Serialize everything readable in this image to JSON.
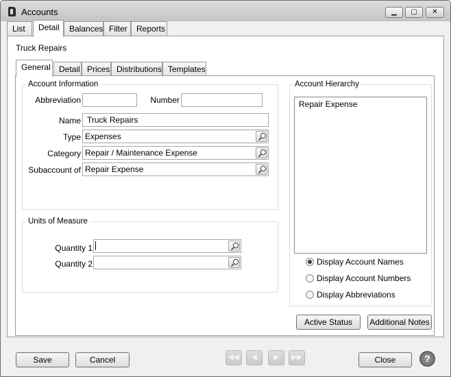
{
  "window": {
    "title": "Accounts",
    "minimize_icon": "minimize-icon",
    "maximize_icon": "maximize-icon",
    "close_icon": "close-icon"
  },
  "main_tabs": [
    "List",
    "Detail",
    "Balances",
    "Filter",
    "Reports"
  ],
  "main_tab_active": "Detail",
  "account_title": "Truck Repairs",
  "sub_tabs": [
    "General",
    "Detail",
    "Prices",
    "Distributions",
    "Templates"
  ],
  "sub_tab_active": "General",
  "account_info": {
    "title": "Account Information",
    "abbreviation_label": "Abbreviation",
    "abbreviation_value": "",
    "number_label": "Number",
    "number_value": "",
    "name_label": "Name",
    "name_value": "Truck Repairs",
    "type_label": "Type",
    "type_value": "Expenses",
    "category_label": "Category",
    "category_value": "Repair / Maintenance Expense",
    "subaccount_label": "Subaccount of",
    "subaccount_value": "Repair Expense"
  },
  "units": {
    "title": "Units of Measure",
    "qty1_label": "Quantity 1",
    "qty1_value": "",
    "qty2_label": "Quantity 2",
    "qty2_value": ""
  },
  "hierarchy": {
    "title": "Account Hierarchy",
    "items": [
      "Repair Expense"
    ],
    "options": [
      "Display Account Names",
      "Display Account Numbers",
      "Display Abbreviations"
    ],
    "selected_option": "Display Account Names"
  },
  "buttons": {
    "active_status": "Active Status",
    "additional_notes": "Additional Notes",
    "save": "Save",
    "cancel": "Cancel",
    "close": "Close",
    "help": "?"
  },
  "nav_icons": [
    "first-record-icon",
    "previous-record-icon",
    "next-record-icon",
    "last-record-icon"
  ],
  "colors": {
    "window_bg": "#f0f0f0",
    "panel_bg": "#ffffff",
    "border": "#9a9a9a"
  }
}
